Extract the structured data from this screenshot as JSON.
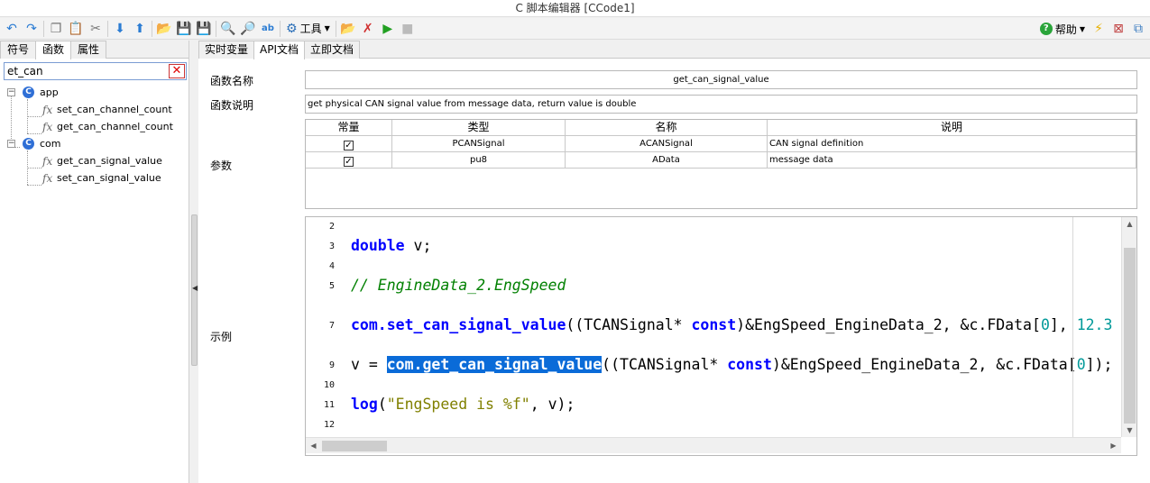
{
  "window": {
    "title": "C 脚本编辑器 [CCode1]"
  },
  "toolbar": {
    "tools_label": "工具",
    "help_label": "帮助"
  },
  "left_panel": {
    "tabs": [
      "符号",
      "函数",
      "属性"
    ],
    "active_tab": 1,
    "search_value": "et_can",
    "tree": [
      {
        "name": "app",
        "children": [
          "set_can_channel_count",
          "get_can_channel_count"
        ]
      },
      {
        "name": "com",
        "children": [
          "get_can_signal_value",
          "set_can_signal_value"
        ]
      }
    ]
  },
  "right_panel": {
    "tabs": [
      "实时变量",
      "API文档",
      "立即文档"
    ],
    "active_tab": 1,
    "func_name_label": "函数名称",
    "func_name": "get_can_signal_value",
    "func_desc_label": "函数说明",
    "func_desc": "get physical CAN signal value from message data, return value is double",
    "params_label": "参数",
    "params_headers": [
      "常量",
      "类型",
      "名称",
      "说明"
    ],
    "params": [
      {
        "const": true,
        "type": "PCANSignal",
        "name": "ACANSignal",
        "desc": "CAN signal definition"
      },
      {
        "const": true,
        "type": "pu8",
        "name": "AData",
        "desc": "message data"
      }
    ],
    "example_label": "示例",
    "code_line_numbers": [
      "2",
      "3",
      "4",
      "5",
      "7",
      "9",
      "10",
      "11",
      "12"
    ]
  },
  "colors": {
    "keyword": "#0000ff",
    "comment": "#008000",
    "string": "#808000",
    "selection": "#0a6bd8"
  }
}
